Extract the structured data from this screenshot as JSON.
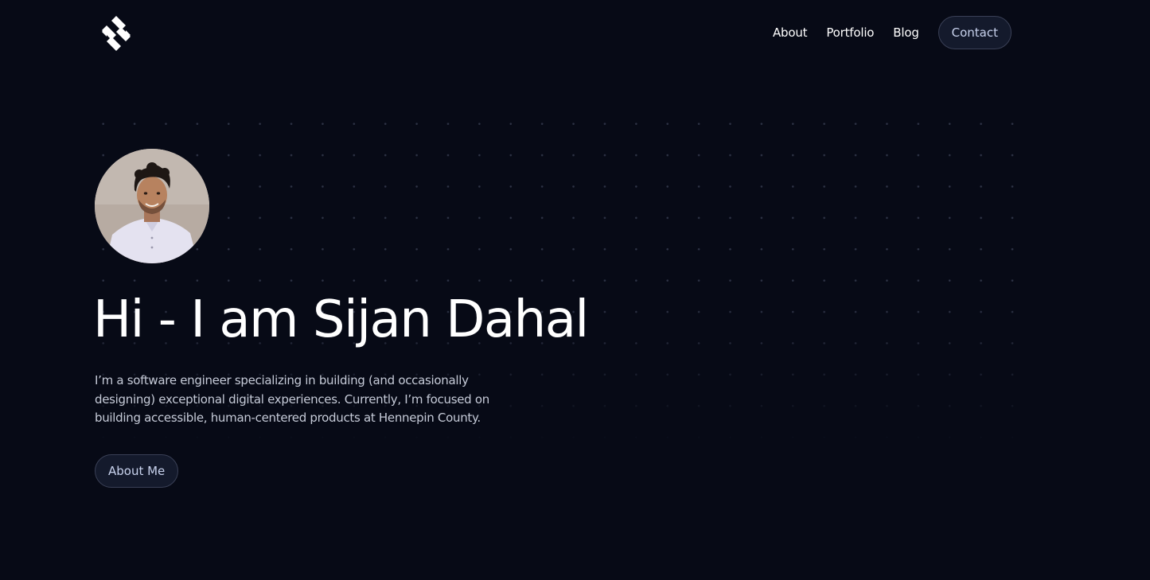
{
  "header": {
    "logo_icon": "s-monogram-logo",
    "nav": [
      {
        "label": "About"
      },
      {
        "label": "Portfolio"
      },
      {
        "label": "Blog"
      }
    ],
    "contact_label": "Contact"
  },
  "hero": {
    "avatar_icon": "profile-photo",
    "title": "Hi - I am Sijan Dahal",
    "description": "I’m a software engineer specializing in building (and occasionally designing) exceptional digital experiences. Currently, I’m focused on building accessible, human-centered products at Hennepin County.",
    "cta_label": "About Me"
  },
  "colors": {
    "background": "#070a16",
    "button_bg": "#141a2c",
    "button_border": "#3a4056",
    "button_text": "#c9d3ee",
    "text_primary": "#ffffff",
    "text_secondary": "#c6cbd8"
  }
}
